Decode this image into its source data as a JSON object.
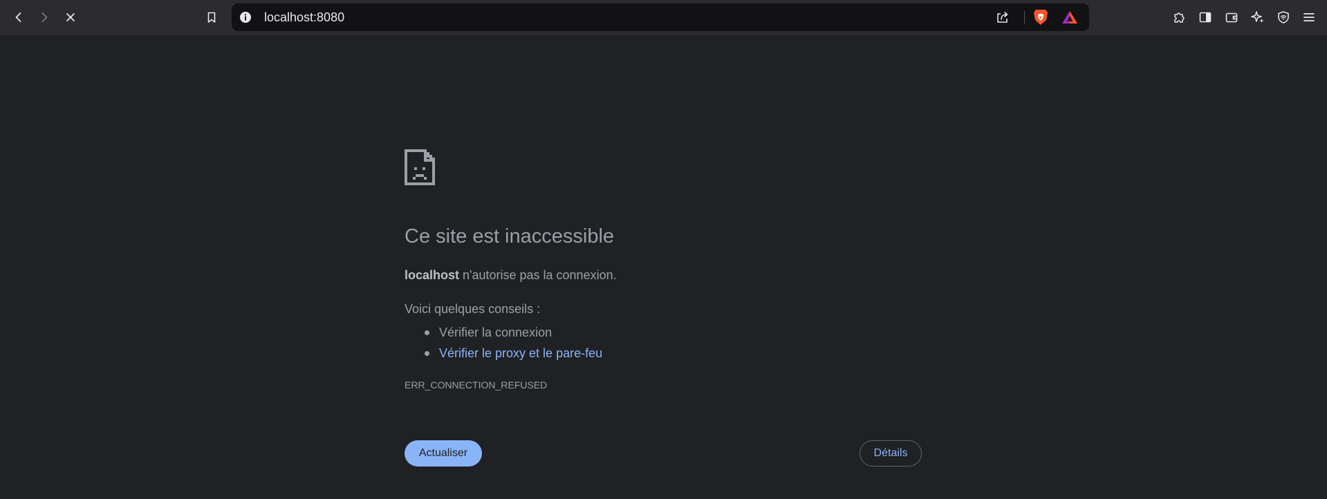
{
  "toolbar": {
    "back_icon": "chevron-left-icon",
    "forward_icon": "chevron-right-icon",
    "stop_icon": "close-icon",
    "bookmark_icon": "bookmark-icon",
    "extensions_icon": "puzzle-icon",
    "sidebar_icon": "sidebar-icon",
    "wallet_icon": "wallet-icon",
    "leo_icon": "sparkle-icon",
    "vpn_icon": "shield-icon",
    "menu_icon": "hamburger-menu-icon"
  },
  "omnibox": {
    "url": "localhost:8080",
    "info_icon": "info-icon",
    "share_icon": "share-icon",
    "shields_icon": "brave-lion-icon",
    "rewards_icon": "brave-rewards-triangle-icon"
  },
  "error": {
    "icon": "sad-page-icon",
    "title": "Ce site est inaccessible",
    "host": "localhost",
    "message_rest": " n'autorise pas la connexion.",
    "tips_heading": "Voici quelques conseils :",
    "tips": [
      {
        "label": "Vérifier la connexion",
        "is_link": false
      },
      {
        "label": "Vérifier le proxy et le pare-feu",
        "is_link": true
      }
    ],
    "code": "ERR_CONNECTION_REFUSED",
    "reload_label": "Actualiser",
    "details_label": "Détails"
  },
  "colors": {
    "page_bg": "#202124",
    "toolbar_bg": "#2b2b30",
    "omnibox_bg": "#121214",
    "text": "#9aa0a6",
    "link": "#8ab4f8",
    "brave_orange": "#fb542b"
  }
}
